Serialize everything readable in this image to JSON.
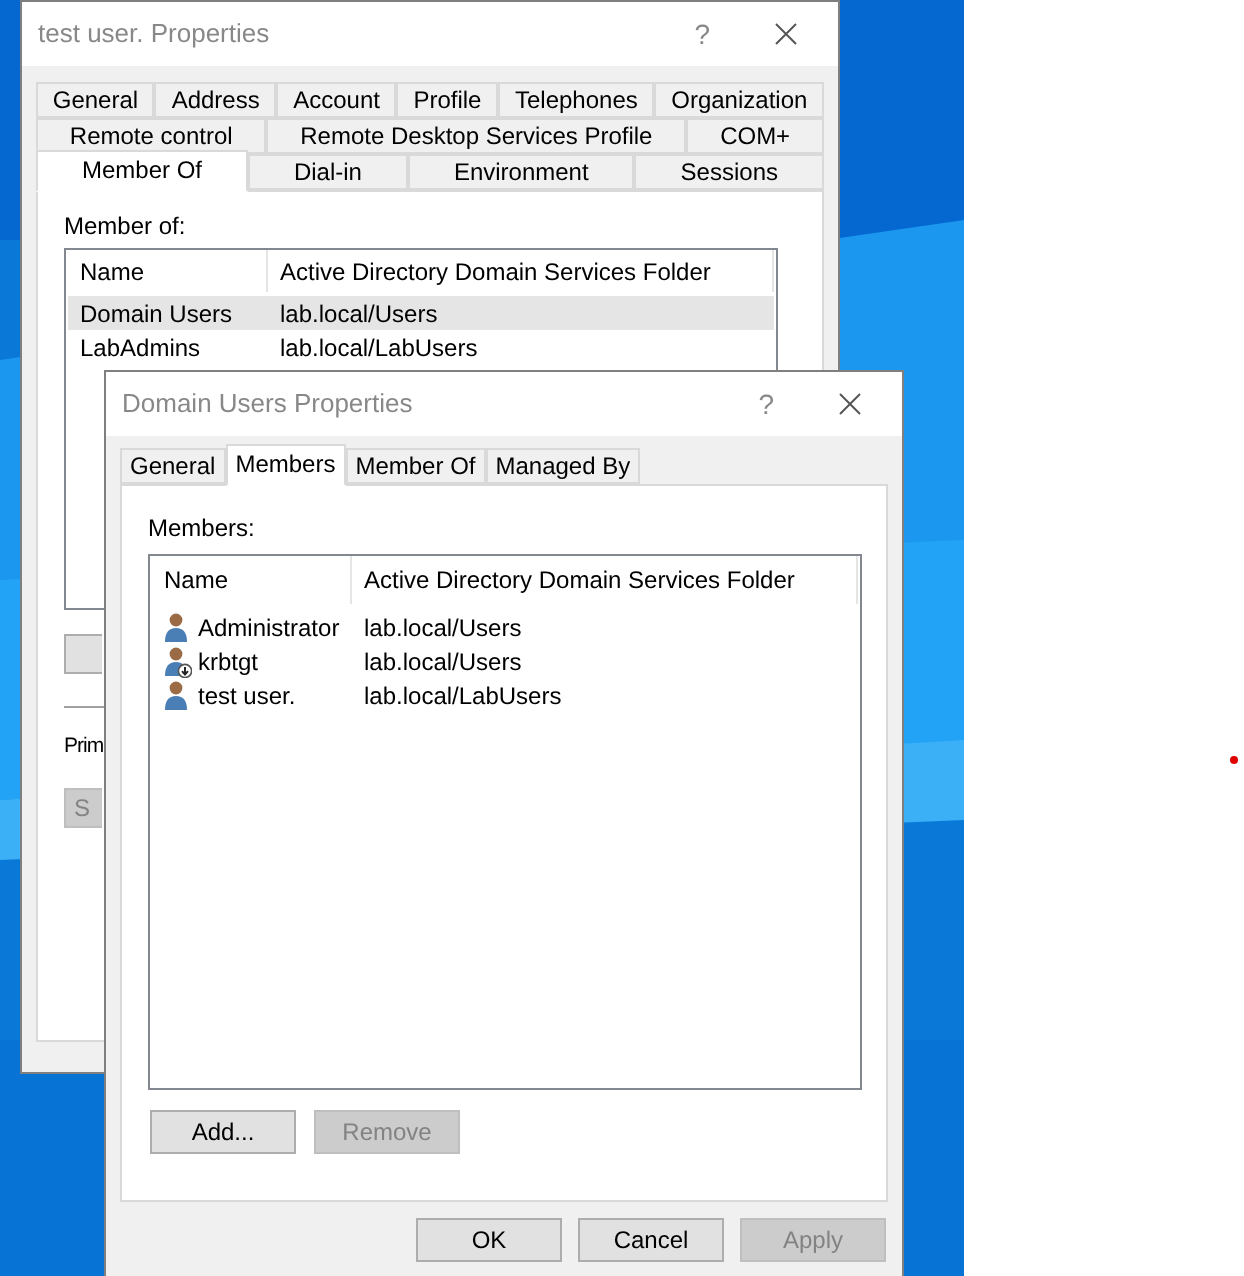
{
  "back_window": {
    "title": "test user. Properties",
    "help": "?",
    "tab_rows": [
      [
        {
          "label": "General",
          "selected": false
        },
        {
          "label": "Address",
          "selected": false
        },
        {
          "label": "Account",
          "selected": false
        },
        {
          "label": "Profile",
          "selected": false
        },
        {
          "label": "Telephones",
          "selected": false
        },
        {
          "label": "Organization",
          "selected": false
        }
      ],
      [
        {
          "label": "Remote control",
          "selected": false
        },
        {
          "label": "Remote Desktop Services Profile",
          "selected": false
        },
        {
          "label": "COM+",
          "selected": false
        }
      ],
      [
        {
          "label": "Member Of",
          "selected": true
        },
        {
          "label": "Dial-in",
          "selected": false
        },
        {
          "label": "Environment",
          "selected": false
        },
        {
          "label": "Sessions",
          "selected": false
        }
      ]
    ],
    "list_label": "Member of:",
    "columns": [
      "Name",
      "Active Directory Domain Services Folder"
    ],
    "rows": [
      {
        "cells": [
          "Domain Users",
          "lab.local/Users"
        ],
        "selected": true
      },
      {
        "cells": [
          "LabAdmins",
          "lab.local/LabUsers"
        ],
        "selected": false
      }
    ],
    "primary_label": "Prim",
    "set_button": "S"
  },
  "front_window": {
    "title": "Domain Users Properties",
    "help": "?",
    "tabs": [
      {
        "label": "General",
        "selected": false
      },
      {
        "label": "Members",
        "selected": true
      },
      {
        "label": "Member Of",
        "selected": false
      },
      {
        "label": "Managed By",
        "selected": false
      }
    ],
    "list_label": "Members:",
    "columns": [
      "Name",
      "Active Directory Domain Services Folder"
    ],
    "rows": [
      {
        "cells": [
          "Administrator",
          "lab.local/Users"
        ],
        "disabled": false
      },
      {
        "cells": [
          "krbtgt",
          "lab.local/Users"
        ],
        "disabled": true
      },
      {
        "cells": [
          "test user.",
          "lab.local/LabUsers"
        ],
        "disabled": false
      }
    ],
    "list_buttons": [
      {
        "label": "Add...",
        "disabled": false
      },
      {
        "label": "Remove",
        "disabled": true
      }
    ],
    "dialog_buttons": [
      {
        "label": "OK",
        "disabled": false
      },
      {
        "label": "Cancel",
        "disabled": false
      },
      {
        "label": "Apply",
        "disabled": true
      }
    ]
  }
}
